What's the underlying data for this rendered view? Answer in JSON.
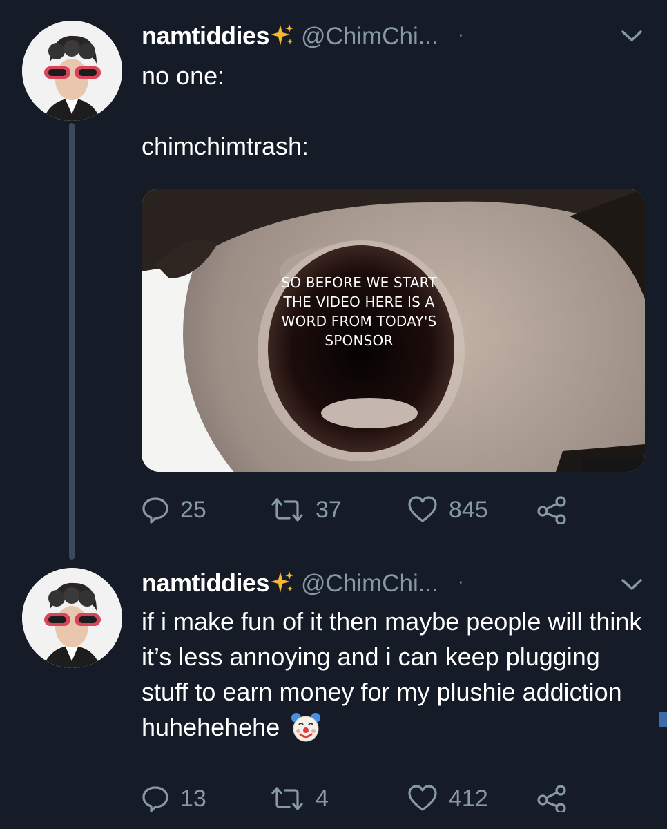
{
  "tweets": [
    {
      "display_name": "namtiddies",
      "handle": "@ChimChi...",
      "separator": "·",
      "text_line1": "no one:",
      "text_line2": "chimchimtrash:",
      "media_caption": "SO BEFORE WE START THE VIDEO HERE IS A WORD FROM TODAY'S SPONSOR",
      "actions": {
        "replies": "25",
        "retweets": "37",
        "likes": "845"
      }
    },
    {
      "display_name": "namtiddies",
      "handle": "@ChimChi...",
      "separator": "·",
      "text": "if i make fun of it then maybe people will think it’s less annoying and i can keep plugging stuff to earn money for my plushie addiction huhehehehe",
      "actions": {
        "replies": "13",
        "retweets": "4",
        "likes": "412"
      }
    }
  ],
  "icons": {
    "name_emoji": "sparkles-icon",
    "tweet_emoji": "clown-face-icon",
    "menu": "chevron-down-icon",
    "reply": "reply-icon",
    "retweet": "retweet-icon",
    "like": "heart-icon",
    "share": "share-icon"
  },
  "colors": {
    "background": "#151c27",
    "secondary_text": "#8899a6",
    "thread_line": "#3a4a5c",
    "sparkle": "#f7b731"
  }
}
